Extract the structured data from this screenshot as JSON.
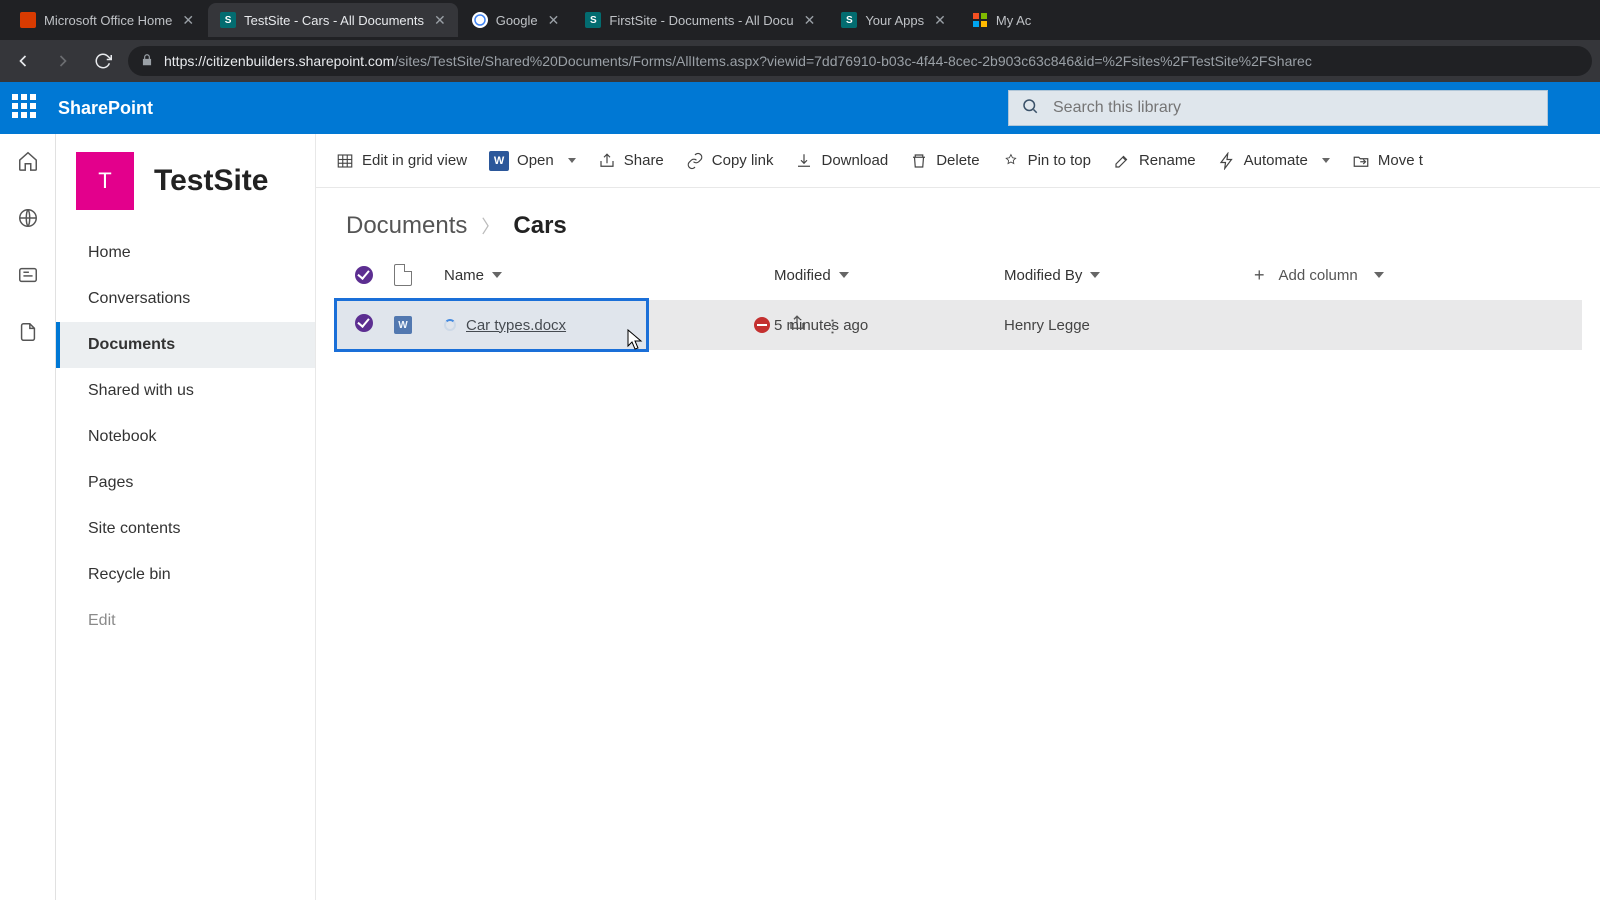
{
  "browser": {
    "tabs": [
      {
        "label": "Microsoft Office Home"
      },
      {
        "label": "TestSite - Cars - All Documents"
      },
      {
        "label": "Google"
      },
      {
        "label": "FirstSite - Documents - All Docu"
      },
      {
        "label": "Your Apps"
      },
      {
        "label": "My Ac"
      }
    ],
    "url_domain": "citizenbuilders.sharepoint.com",
    "url_rest": "/sites/TestSite/Shared%20Documents/Forms/AllItems.aspx?viewid=7dd76910-b03c-4f44-8cec-2b903c63c846&id=%2Fsites%2FTestSite%2FSharec"
  },
  "suite": {
    "brand": "SharePoint",
    "search_placeholder": "Search this library"
  },
  "site": {
    "logo_initial": "T",
    "title": "TestSite",
    "nav": {
      "home": "Home",
      "conversations": "Conversations",
      "documents": "Documents",
      "shared": "Shared with us",
      "notebook": "Notebook",
      "pages": "Pages",
      "contents": "Site contents",
      "recycle": "Recycle bin",
      "edit": "Edit"
    }
  },
  "cmdbar": {
    "edit_grid": "Edit in grid view",
    "open": "Open",
    "share": "Share",
    "copy_link": "Copy link",
    "download": "Download",
    "delete": "Delete",
    "pin": "Pin to top",
    "rename": "Rename",
    "automate": "Automate",
    "move": "Move t"
  },
  "breadcrumb": {
    "root": "Documents",
    "leaf": "Cars"
  },
  "table": {
    "columns": {
      "name": "Name",
      "modified": "Modified",
      "modified_by": "Modified By",
      "add": "Add column"
    },
    "rows": [
      {
        "name": "Car types.docx",
        "modified": "5 minutes ago",
        "modified_by": "Henry Legge"
      }
    ]
  }
}
